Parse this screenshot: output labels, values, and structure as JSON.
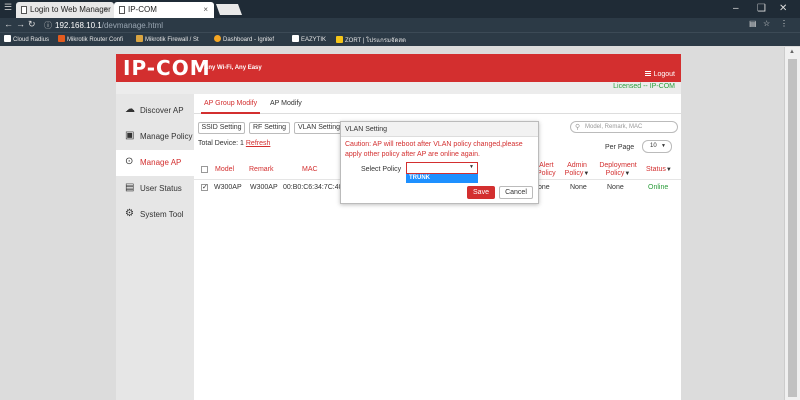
{
  "browser": {
    "tabs": [
      {
        "title": "Login to Web Manager"
      },
      {
        "title": "IP-COM"
      }
    ],
    "url_host": "192.168.10.1",
    "url_path": "/devmanage.html",
    "bookmarks": [
      {
        "label": "Cloud Radius"
      },
      {
        "label": "Mikrotik Router Confi"
      },
      {
        "label": "Mikrotik Firewall / St"
      },
      {
        "label": "Dashboard - Ignitef"
      },
      {
        "label": "EAZYTIK"
      },
      {
        "label": "ZORT | โปรแกรมจัดสต"
      }
    ]
  },
  "header": {
    "logo": "IP-COM",
    "tagline": "Any Wi-Fi, Any Easy",
    "logout": "Logout",
    "licensed": "Licensed -- IP-COM"
  },
  "sidebar": {
    "items": [
      {
        "label": "Discover AP",
        "icon": "☁"
      },
      {
        "label": "Manage Policy",
        "icon": "▣"
      },
      {
        "label": "Manage AP",
        "icon": "⊙"
      },
      {
        "label": "User Status",
        "icon": "▤"
      },
      {
        "label": "System Tool",
        "icon": "⚙"
      }
    ]
  },
  "main": {
    "tabs": [
      {
        "label": "AP Group Modify"
      },
      {
        "label": "AP Modify"
      }
    ],
    "toolbar": {
      "ssid": "SSID Setting",
      "rf": "RF Setting",
      "vlan": "VLAN Setting"
    },
    "search_placeholder": "Model, Remark, MAC",
    "total_label": "Total Device: 1",
    "refresh": "Refresh",
    "per_page_label": "Per Page",
    "per_page_value": "10",
    "columns": {
      "model": "Model",
      "remark": "Remark",
      "mac": "MAC",
      "alert_1": "Alert",
      "alert_2": "Policy",
      "admin_1": "Admin",
      "admin_2": "Policy",
      "deploy_1": "Deployment",
      "deploy_2": "Policy",
      "status": "Status"
    },
    "row": {
      "model": "W300AP",
      "remark": "W300AP",
      "mac": "00:B0:C6:34:7C:40",
      "alert": "one",
      "admin": "None",
      "deploy": "None",
      "status": "Online"
    }
  },
  "modal": {
    "title": "VLAN Setting",
    "caution": "Caution: AP will reboot after VLAN policy changed,please apply other policy after AP are online again.",
    "select_label": "Select Policy",
    "option": "TRUNK",
    "save": "Save",
    "cancel": "Cancel"
  },
  "colors": {
    "brand_red": "#d32f2f",
    "online_green": "#2a9d3a",
    "highlight_blue": "#1e90ff"
  }
}
